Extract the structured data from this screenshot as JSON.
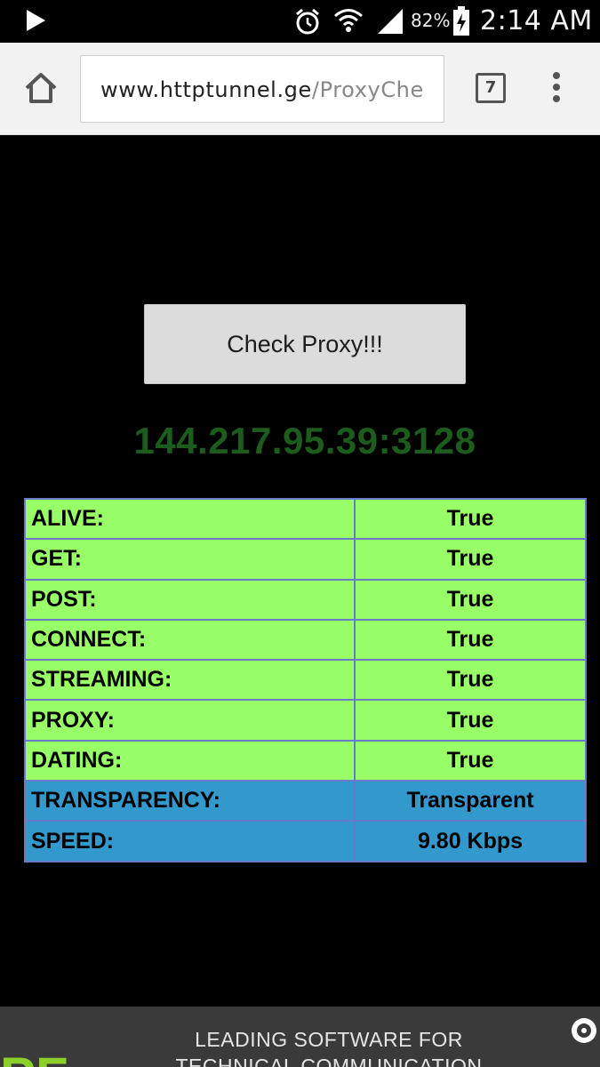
{
  "status_bar": {
    "battery_percent": "82%",
    "time": "2:14 AM"
  },
  "browser": {
    "url_host": "www.httptunnel.ge",
    "url_path": "/ProxyChe",
    "tab_count": "7"
  },
  "page": {
    "check_button_label": "Check Proxy!!!",
    "proxy_address": "144.217.95.39:3128",
    "results": [
      {
        "label": "ALIVE:",
        "value": "True"
      },
      {
        "label": "GET:",
        "value": "True"
      },
      {
        "label": "POST:",
        "value": "True"
      },
      {
        "label": "CONNECT:",
        "value": "True"
      },
      {
        "label": "STREAMING:",
        "value": "True"
      },
      {
        "label": "PROXY:",
        "value": "True"
      },
      {
        "label": "DATING:",
        "value": "True"
      },
      {
        "label": "TRANSPARENCY:",
        "value": "Transparent"
      },
      {
        "label": "SPEED:",
        "value": "9.80 Kbps"
      }
    ],
    "colors": {
      "green_row": "#99ff66",
      "blue_row": "#3399cc",
      "proxy_address": "#1c5c1c"
    }
  },
  "ad": {
    "logo_text": "PF",
    "line1": "LEADING SOFTWARE FOR",
    "line2": "TECHNICAL COMMUNICATION"
  }
}
